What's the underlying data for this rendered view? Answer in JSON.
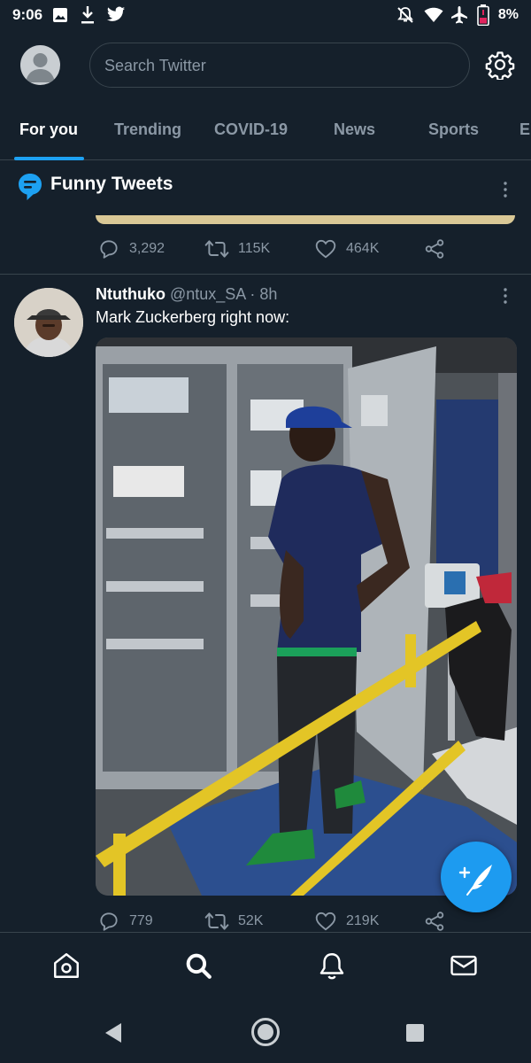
{
  "status_bar": {
    "time": "9:06",
    "battery_percent": "8%",
    "left_icons": [
      "image-icon",
      "download-icon",
      "twitter-bird-icon"
    ],
    "right_icons": [
      "notifications-off-icon",
      "wifi-icon",
      "airplane-icon",
      "battery-low-icon"
    ]
  },
  "header": {
    "search_placeholder": "Search Twitter"
  },
  "tabs": [
    {
      "label": "For you",
      "active": true
    },
    {
      "label": "Trending",
      "active": false
    },
    {
      "label": "COVID-19",
      "active": false
    },
    {
      "label": "News",
      "active": false
    },
    {
      "label": "Sports",
      "active": false
    },
    {
      "label": "E",
      "active": false
    }
  ],
  "topic": {
    "title": "Funny Tweets"
  },
  "previous_tweet": {
    "replies": "3,292",
    "retweets": "115K",
    "likes": "464K"
  },
  "tweet": {
    "name": "Ntuthuko",
    "meta": "@ntux_SA · 8h",
    "text": "Mark Zuckerberg right now:",
    "replies": "779",
    "retweets": "52K",
    "likes": "219K"
  },
  "colors": {
    "background": "#15202b",
    "accent": "#1da1f2",
    "secondary_text": "#8b98a5",
    "divider": "#38444d"
  }
}
